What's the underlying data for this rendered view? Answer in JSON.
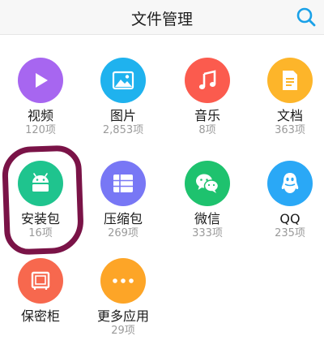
{
  "header": {
    "title": "文件管理",
    "search_icon": "search-icon",
    "accent": "#1aa1e8"
  },
  "categories": [
    {
      "label": "视频",
      "count": "120项",
      "icon": "play-icon",
      "color": "#a766f0"
    },
    {
      "label": "图片",
      "count": "2,853项",
      "icon": "image-icon",
      "color": "#1fb2ee"
    },
    {
      "label": "音乐",
      "count": "8项",
      "icon": "music-note-icon",
      "color": "#fb5b4e"
    },
    {
      "label": "文档",
      "count": "363项",
      "icon": "document-icon",
      "color": "#fdb52a"
    },
    {
      "label": "安装包",
      "count": "16项",
      "icon": "android-icon",
      "color": "#1fc48e"
    },
    {
      "label": "压缩包",
      "count": "269项",
      "icon": "archive-icon",
      "color": "#7877f5"
    },
    {
      "label": "微信",
      "count": "333项",
      "icon": "wechat-icon",
      "color": "#1ec26e"
    },
    {
      "label": "QQ",
      "count": "235项",
      "icon": "qq-icon",
      "color": "#2aa8f6"
    },
    {
      "label": "保密柜",
      "count": "",
      "icon": "safe-icon",
      "color": "#f7684e"
    },
    {
      "label": "更多应用",
      "count": "29项",
      "icon": "more-icon",
      "color": "#fda527"
    }
  ],
  "annotation": {
    "color": "#7a1347"
  }
}
